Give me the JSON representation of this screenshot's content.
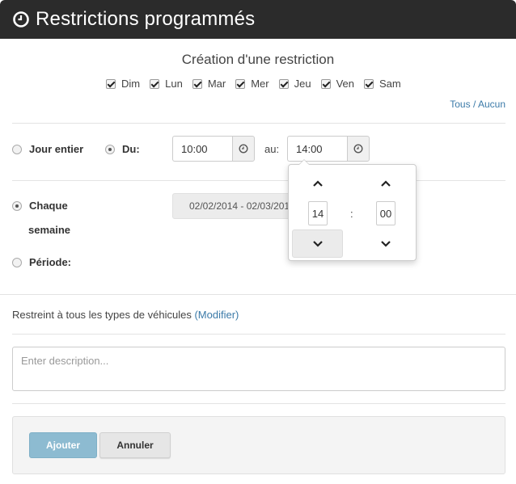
{
  "header": {
    "title": "Restrictions programmés",
    "icon": "clock-icon"
  },
  "form": {
    "subtitle": "Création d'une restriction",
    "days": [
      {
        "label": "Dim",
        "checked": true
      },
      {
        "label": "Lun",
        "checked": true
      },
      {
        "label": "Mar",
        "checked": true
      },
      {
        "label": "Mer",
        "checked": true
      },
      {
        "label": "Jeu",
        "checked": true
      },
      {
        "label": "Ven",
        "checked": true
      },
      {
        "label": "Sam",
        "checked": true
      }
    ],
    "tous_label": "Tous",
    "sep": "/",
    "aucun_label": "Aucun",
    "jour_entier_label": "Jour entier",
    "du_label": "Du:",
    "du_value": "10:00",
    "au_label": "au:",
    "au_value": "14:00",
    "chaque_semaine_line1": "Chaque",
    "chaque_semaine_line2": "semaine",
    "periode_label": "Période:",
    "date_range": "02/02/2014 - 02/03/2014",
    "restrict_text": "Restreint à tous les types de véhicules",
    "modifier_label": "(Modifier)",
    "description_placeholder": "Enter description...",
    "ajouter_label": "Ajouter",
    "annuler_label": "Annuler"
  },
  "timepicker": {
    "hours": "14",
    "separator": ":",
    "minutes": "00"
  },
  "colors": {
    "header_bg": "#2b2b2b",
    "link": "#3b7aa8",
    "primary_button": "#8dbbd1"
  }
}
